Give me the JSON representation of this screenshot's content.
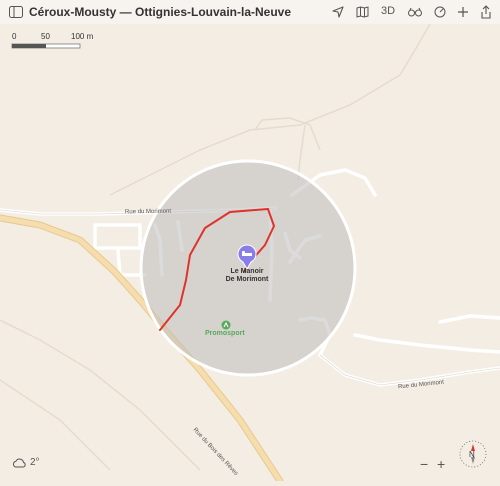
{
  "window": {
    "title": "Céroux-Mousty — Ottignies-Louvain-la-Neuve",
    "view_3d_label": "3D",
    "zoom_in_label": "+",
    "zoom_out_label": "−"
  },
  "scale": {
    "labels": [
      "0",
      "50",
      "100 m"
    ]
  },
  "map": {
    "place": {
      "name_line1": "Le Manoir",
      "name_line2": "De Morimont"
    },
    "poi": {
      "name": "Promosport"
    },
    "roads": [
      "Rue du Morimont",
      "Rue du Morimont",
      "Rue du Bois des Rêves"
    ]
  },
  "weather": {
    "temperature": "2°",
    "icon": "cloud-icon"
  },
  "compass": {
    "label": "N"
  },
  "colors": {
    "route": "#e0322c",
    "pin": "#8a7de8",
    "poi": "#5aa85a",
    "highway": "#f6ddb0"
  }
}
